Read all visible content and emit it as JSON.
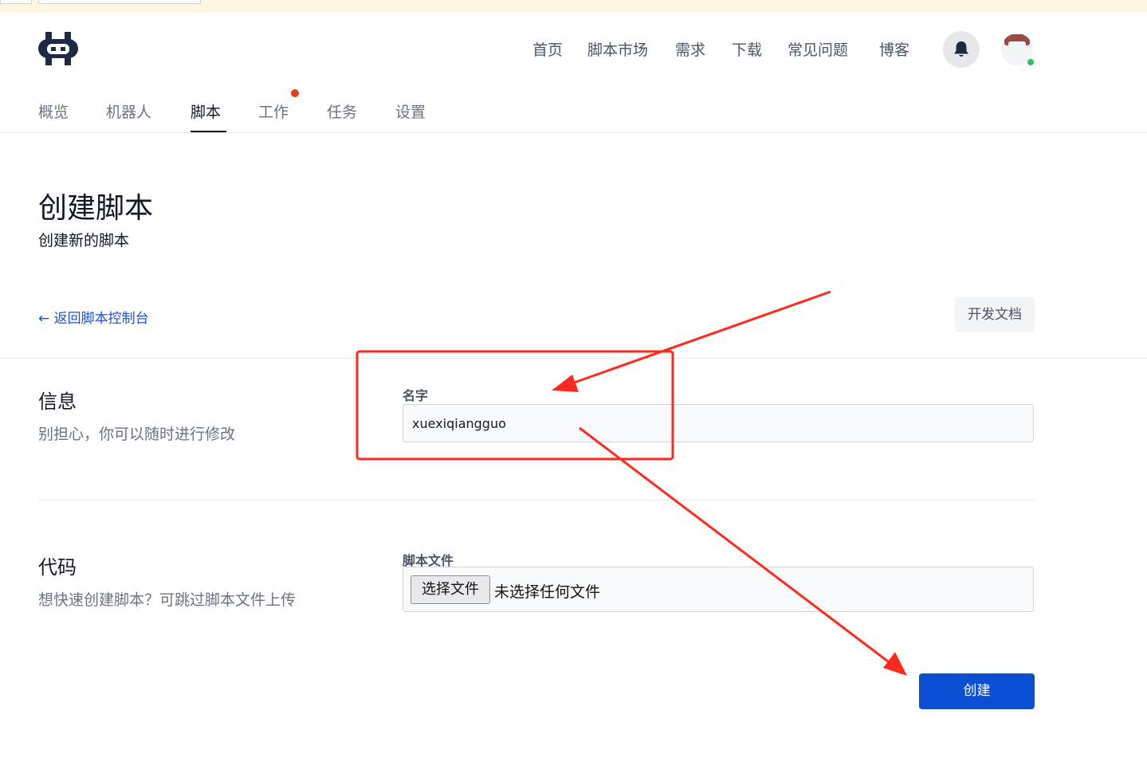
{
  "top_nav": {
    "items": [
      "首页",
      "脚本市场",
      "需求",
      "下载",
      "常见问题",
      "博客"
    ]
  },
  "tabs": {
    "items": [
      "概览",
      "机器人",
      "脚本",
      "工作",
      "任务",
      "设置"
    ],
    "active": "脚本"
  },
  "page": {
    "title": "创建脚本",
    "subtitle": "创建新的脚本",
    "back_link": "← 返回脚本控制台",
    "docs_button": "开发文档"
  },
  "info_section": {
    "title": "信息",
    "description": "别担心，你可以随时进行修改",
    "name_label": "名字",
    "name_value": "xuexiqiangguo"
  },
  "code_section": {
    "title": "代码",
    "description": "想快速创建脚本？可跳过脚本文件上传",
    "file_label": "脚本文件",
    "file_button": "选择文件",
    "file_status": "未选择任何文件"
  },
  "create_button": "创建",
  "colors": {
    "primary": "#0b50d3",
    "link": "#1d4ed8",
    "annotation": "#ff2a1f",
    "notification_dot": "#e23d1c",
    "online_dot": "#22c55e"
  },
  "icons": [
    "robot-logo-icon",
    "bell-icon",
    "avatar-icon"
  ]
}
